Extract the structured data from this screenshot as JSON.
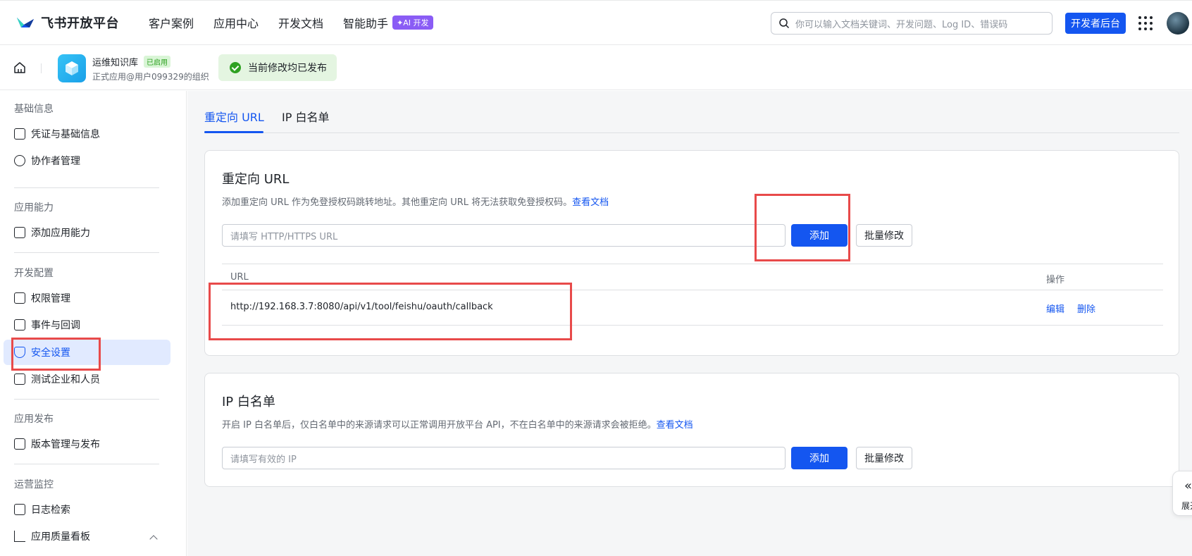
{
  "header": {
    "logo_text": "飞书开放平台",
    "nav": [
      "客户案例",
      "应用中心",
      "开发文档",
      "智能助手"
    ],
    "ai_badge": "✦AI 开发",
    "search_placeholder": "你可以输入文档关键词、开发问题、Log ID、错误码",
    "dev_console": "开发者后台"
  },
  "appbar": {
    "app_name": "运维知识库",
    "status": "已启用",
    "org": "正式应用@用户099329的组织",
    "publish_status": "当前修改均已发布"
  },
  "sidebar": {
    "groups": [
      {
        "title": "基础信息",
        "items": [
          "凭证与基础信息",
          "协作者管理"
        ]
      },
      {
        "title": "应用能力",
        "items": [
          "添加应用能力"
        ]
      },
      {
        "title": "开发配置",
        "items": [
          "权限管理",
          "事件与回调",
          "安全设置",
          "测试企业和人员"
        ]
      },
      {
        "title": "应用发布",
        "items": [
          "版本管理与发布"
        ]
      },
      {
        "title": "运营监控",
        "items": [
          "日志检索",
          "应用质量看板"
        ]
      }
    ],
    "active_item": "安全设置"
  },
  "tabs": [
    "重定向 URL",
    "IP 白名单"
  ],
  "redirect": {
    "title": "重定向 URL",
    "desc": "添加重定向 URL 作为免登授权码跳转地址。其他重定向 URL 将无法获取免登授权码。",
    "doc_link": "查看文档",
    "input_placeholder": "请填写 HTTP/HTTPS URL",
    "add_label": "添加",
    "bulk_label": "批量修改",
    "table": {
      "col_url": "URL",
      "col_ops": "操作",
      "rows": [
        {
          "url": "http://192.168.3.7:8080/api/v1/tool/feishu/oauth/callback",
          "edit": "编辑",
          "delete": "删除"
        }
      ]
    }
  },
  "ip_whitelist": {
    "title": "IP 白名单",
    "desc": "开启 IP 白名单后，仅白名单中的来源请求可以正常调用开放平台 API，不在白名单中的来源请求会被拒绝。",
    "doc_link": "查看文档",
    "input_placeholder": "请填写有效的 IP",
    "add_label": "添加",
    "bulk_label": "批量修改"
  },
  "expand_label": "展开",
  "colors": {
    "primary": "#1456f0",
    "success": "#2ea121",
    "annotation": "#e84a4a"
  }
}
